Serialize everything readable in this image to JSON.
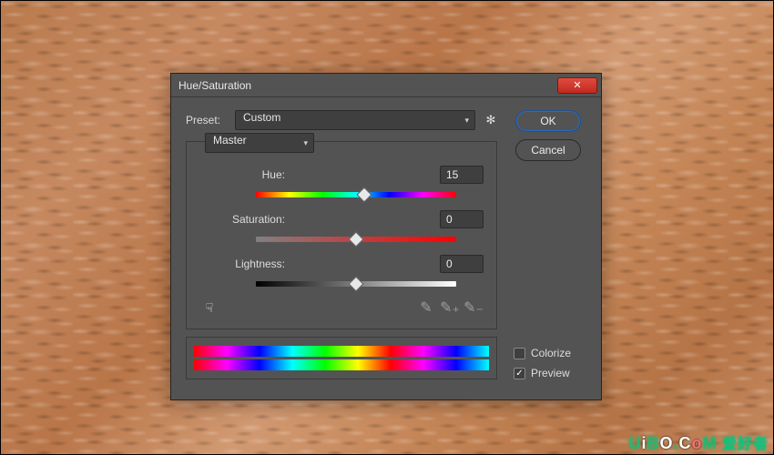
{
  "dialog": {
    "title": "Hue/Saturation",
    "preset_label": "Preset:",
    "preset_value": "Custom",
    "channel_value": "Master",
    "sliders": {
      "hue": {
        "label": "Hue:",
        "value": "15",
        "percent": 54
      },
      "saturation": {
        "label": "Saturation:",
        "value": "0",
        "percent": 50
      },
      "lightness": {
        "label": "Lightness:",
        "value": "0",
        "percent": 50
      }
    },
    "buttons": {
      "ok": "OK",
      "cancel": "Cancel"
    },
    "colorize": {
      "label": "Colorize",
      "checked": false
    },
    "preview": {
      "label": "Preview",
      "checked": true
    },
    "icons": {
      "close": "✕",
      "gear": "✻",
      "chevron": "▾",
      "hand": "☟",
      "eyedropper": "✎",
      "eyedropper_plus": "✎₊",
      "eyedropper_minus": "✎₋"
    }
  },
  "watermark": {
    "text": "UiBO.CoM",
    "cn": " 爱好者"
  }
}
